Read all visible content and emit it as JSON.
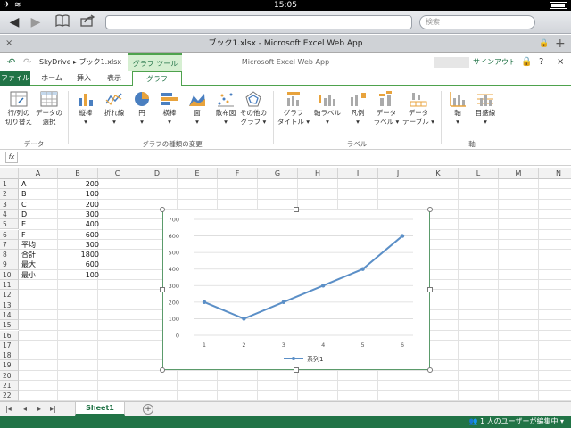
{
  "status": {
    "time": "15:05",
    "airplane_icon": "airplane-icon",
    "wifi_icon": "wifi-icon",
    "battery_icon": "battery-icon"
  },
  "safari": {
    "search_placeholder": "検索"
  },
  "window": {
    "title": "ブック1.xlsx - Microsoft Excel Web App",
    "close": "×",
    "add_tab": "+"
  },
  "apptop": {
    "undo": "↶",
    "redo": "↷",
    "breadcrumb": "SkyDrive ▸ ブック1.xlsx",
    "context_tab": "グラフ ツール",
    "app_name": "Microsoft Excel Web App",
    "signout": "サインアウト",
    "help": "?",
    "close": "×"
  },
  "tabs": [
    {
      "label": "ファイル"
    },
    {
      "label": "ホーム"
    },
    {
      "label": "挿入"
    },
    {
      "label": "表示"
    },
    {
      "label": "グラフ"
    }
  ],
  "ribbon": {
    "buttons": [
      {
        "label1": "行/列の",
        "label2": "切り替え"
      },
      {
        "label1": "データの",
        "label2": "選択"
      },
      {
        "label1": "縦棒",
        "label2": "▾"
      },
      {
        "label1": "折れ線",
        "label2": "▾"
      },
      {
        "label1": "円",
        "label2": "▾"
      },
      {
        "label1": "横棒",
        "label2": "▾"
      },
      {
        "label1": "面",
        "label2": "▾"
      },
      {
        "label1": "散布図",
        "label2": "▾"
      },
      {
        "label1": "その他の",
        "label2": "グラフ ▾"
      },
      {
        "label1": "グラフ",
        "label2": "タイトル ▾"
      },
      {
        "label1": "軸ラベル",
        "label2": "▾"
      },
      {
        "label1": "凡例",
        "label2": "▾"
      },
      {
        "label1": "データ",
        "label2": "ラベル ▾"
      },
      {
        "label1": "データ",
        "label2": "テーブル ▾"
      },
      {
        "label1": "軸",
        "label2": "▾"
      },
      {
        "label1": "目盛線",
        "label2": "▾"
      }
    ],
    "groups": [
      {
        "label": "データ"
      },
      {
        "label": "グラフの種類の変更"
      },
      {
        "label": "ラベル"
      },
      {
        "label": "軸"
      }
    ]
  },
  "formula_bar": {
    "fx": "fx",
    "value": ""
  },
  "grid": {
    "columns": [
      "A",
      "B",
      "C",
      "D",
      "E",
      "F",
      "G",
      "H",
      "I",
      "J",
      "K",
      "L",
      "M",
      "N"
    ],
    "rows": [
      "1",
      "2",
      "3",
      "4",
      "5",
      "6",
      "7",
      "8",
      "9",
      "10",
      "11",
      "12",
      "13",
      "14",
      "15",
      "16",
      "17",
      "18",
      "19",
      "20",
      "21",
      "22"
    ],
    "cells": [
      {
        "a": "A",
        "b": "200"
      },
      {
        "a": "B",
        "b": "100"
      },
      {
        "a": "C",
        "b": "200"
      },
      {
        "a": "D",
        "b": "300"
      },
      {
        "a": "E",
        "b": "400"
      },
      {
        "a": "F",
        "b": "600"
      },
      {
        "a": "平均",
        "b": "300"
      },
      {
        "a": "合計",
        "b": "1800"
      },
      {
        "a": "最大",
        "b": "600"
      },
      {
        "a": "最小",
        "b": "100"
      }
    ]
  },
  "chart_data": {
    "type": "line",
    "categories": [
      "1",
      "2",
      "3",
      "4",
      "5",
      "6"
    ],
    "series": [
      {
        "name": "系列1",
        "values": [
          200,
          100,
          200,
          300,
          400,
          600
        ],
        "color": "#5b8fc7"
      }
    ],
    "title": "",
    "xlabel": "",
    "ylabel": "",
    "ylim": [
      0,
      700
    ],
    "yticks": [
      "0",
      "100",
      "200",
      "300",
      "400",
      "500",
      "600",
      "700"
    ],
    "grid": true,
    "legend": "bottom"
  },
  "sheets": [
    {
      "label": "Sheet1"
    }
  ],
  "sheet_nav": {
    "first": "|◂",
    "prev": "◂",
    "next": "▸",
    "last": "▸|",
    "add": "+"
  },
  "footer": {
    "editing": "1 人のユーザーが編集中 ▾"
  },
  "colors": {
    "accent": "#217346",
    "chart_border": "#5b9b6b",
    "series": "#5b8fc7"
  }
}
